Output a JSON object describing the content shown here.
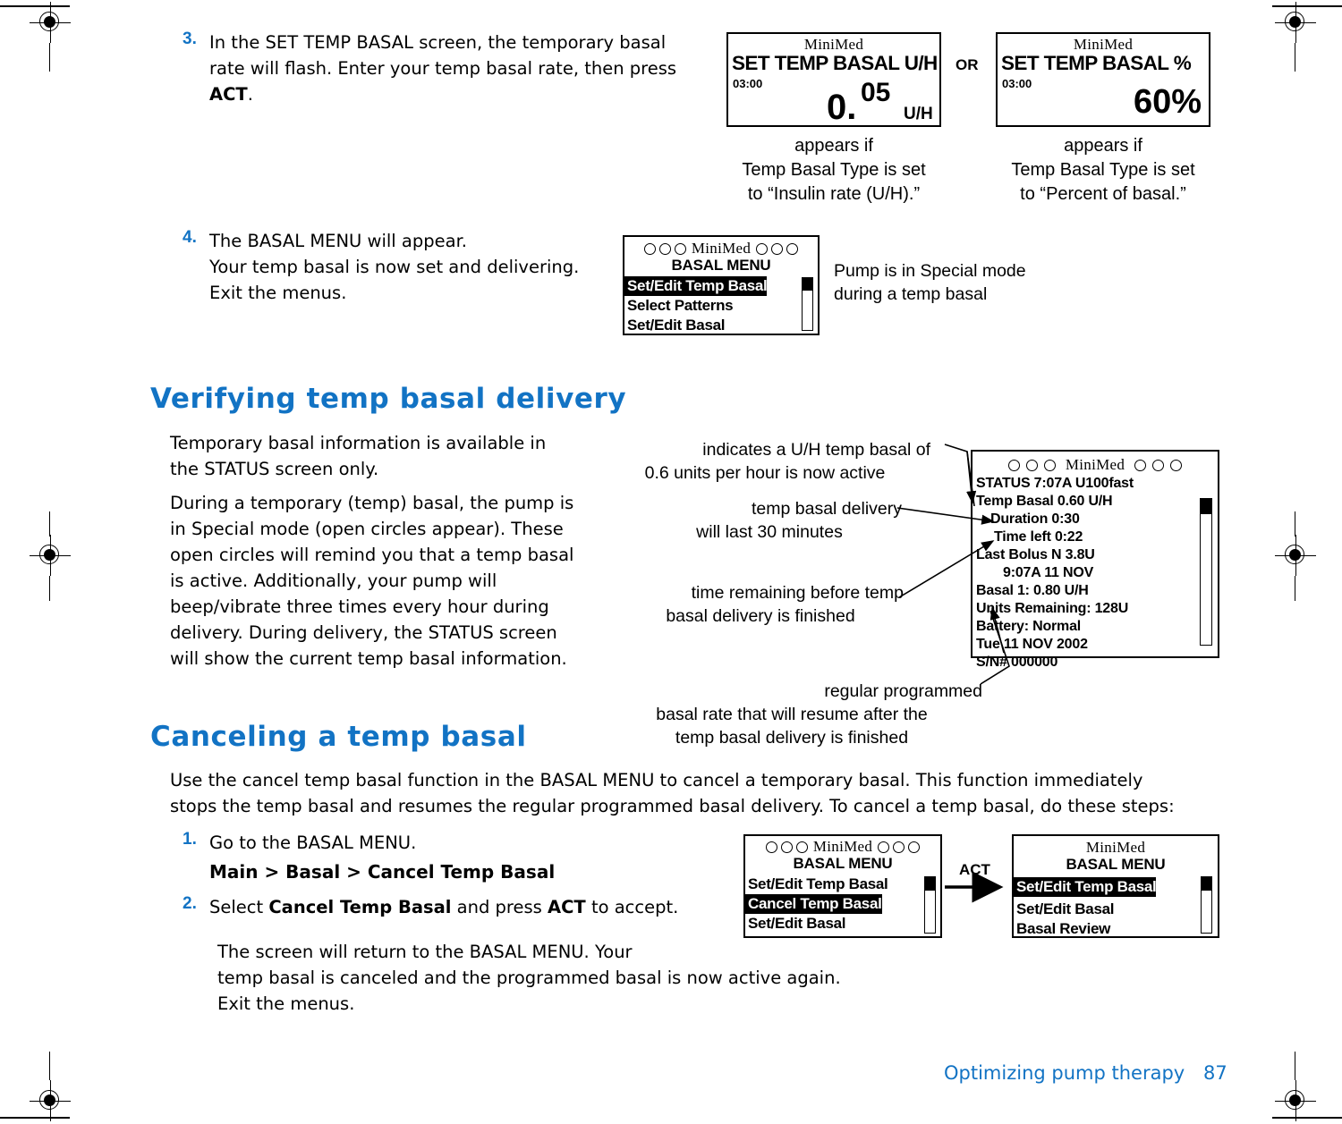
{
  "page": {
    "footer_section": "Optimizing pump therapy",
    "footer_page_number": "87"
  },
  "step3": {
    "number": "3.",
    "text_line1": "In the SET TEMP BASAL screen, the temporary basal",
    "text_line2": "rate will flash. Enter your temp basal rate, then press",
    "text_bold": "ACT",
    "text_end": "."
  },
  "screen_uh": {
    "brand": "MiniMed",
    "title": "SET TEMP BASAL U/H",
    "time": "03:00",
    "value_int": "0.",
    "value_frac": "05",
    "units": "U/H"
  },
  "or_label": "OR",
  "screen_pct": {
    "brand": "MiniMed",
    "title": "SET TEMP BASAL %",
    "time": "03:00",
    "value": "60%"
  },
  "caption_uh": {
    "line1": "appears if",
    "line2": "Temp Basal Type is set",
    "line3": "to “Insulin rate (U/H).”"
  },
  "caption_pct": {
    "line1": "appears if",
    "line2": "Temp Basal Type is set",
    "line3": "to “Percent of basal.”"
  },
  "step4": {
    "number": "4.",
    "line1": "The BASAL MENU will appear.",
    "line2": "Your temp basal is now set and delivering.",
    "line3": "Exit the menus."
  },
  "screen_basal_menu_4": {
    "brand": "MiniMed",
    "title": "BASAL MENU",
    "items": [
      {
        "label": "Set/Edit Temp Basal",
        "selected": true
      },
      {
        "label": "Select Patterns",
        "selected": false
      },
      {
        "label": "Set/Edit Basal",
        "selected": false
      }
    ]
  },
  "note_special_mode": {
    "line1": "Pump is in Special mode",
    "line2": "during a temp basal"
  },
  "section_verifying": {
    "heading": "Verifying temp basal delivery",
    "para1_line1": "Temporary basal information is available in",
    "para1_line2": "the STATUS screen only.",
    "para2_line1": "During a temporary (temp) basal, the pump is",
    "para2_line2": "in Special mode (open circles appear). These",
    "para2_line3": "open circles will remind you that a temp basal",
    "para2_line4": "is active. Additionally, your pump will",
    "para2_line5": "beep/vibrate three times every hour during",
    "para2_line6": "delivery. During delivery, the STATUS screen",
    "para2_line7": "will show the current temp basal information."
  },
  "callouts": {
    "temp_basal_rate_line1": "indicates a U/H temp basal of",
    "temp_basal_rate_line2": "0.6 units per hour is now active",
    "duration_line1": "temp basal delivery",
    "duration_line2": "will last 30 minutes",
    "time_left_line1": "time remaining before temp",
    "time_left_line2": "basal delivery is finished",
    "basal1_line1": "regular programmed",
    "basal1_line2": "basal rate that will resume after the",
    "basal1_line3": "temp basal delivery is finished"
  },
  "screen_status": {
    "brand": "MiniMed",
    "lines": [
      "STATUS 7:07A U100fast",
      "Temp Basal 0.60 U/H",
      "Duration 0:30",
      "Time left 0:22",
      "Last Bolus N 3.8U",
      "9:07A 11 NOV",
      "Basal 1: 0.80 U/H",
      "Units Remaining: 128U",
      "Battery: Normal",
      "Tue 11 NOV 2002",
      "S/N# 000000"
    ]
  },
  "section_canceling": {
    "heading": "Canceling a temp basal",
    "para_line1": "Use the cancel temp basal function in the BASAL MENU to cancel a temporary basal. This function immediately",
    "para_line2": "stops the temp basal and resumes the regular programmed basal delivery. To cancel a temp basal, do these steps:"
  },
  "step_c1": {
    "number": "1.",
    "text": "Go to the BASAL MENU.",
    "path": "Main > Basal > Cancel Temp Basal"
  },
  "step_c2": {
    "number": "2.",
    "prefix": "Select ",
    "bold1": "Cancel Temp Basal",
    "middle": " and press ",
    "bold2": "ACT",
    "suffix": " to accept."
  },
  "cancel_result": {
    "line1": "The screen will return to the BASAL MENU. Your",
    "line2": "temp basal is canceled and the programmed basal is now active again.",
    "line3": "Exit the menus."
  },
  "screen_basal_menu_before": {
    "brand": "MiniMed",
    "title": "BASAL MENU",
    "items": [
      {
        "label": "Set/Edit Temp Basal",
        "selected": false
      },
      {
        "label": "Cancel Temp Basal",
        "selected": true
      },
      {
        "label": "Set/Edit Basal",
        "selected": false
      }
    ]
  },
  "act_arrow_label": "ACT",
  "screen_basal_menu_after": {
    "brand": "MiniMed",
    "title": "BASAL MENU",
    "items": [
      {
        "label": "Set/Edit Temp Basal",
        "selected": true
      },
      {
        "label": "Set/Edit Basal",
        "selected": false
      },
      {
        "label": "Basal Review",
        "selected": false
      }
    ]
  },
  "colors": {
    "accent_blue": "#1273c4",
    "ink": "#000000",
    "paper": "#ffffff"
  }
}
